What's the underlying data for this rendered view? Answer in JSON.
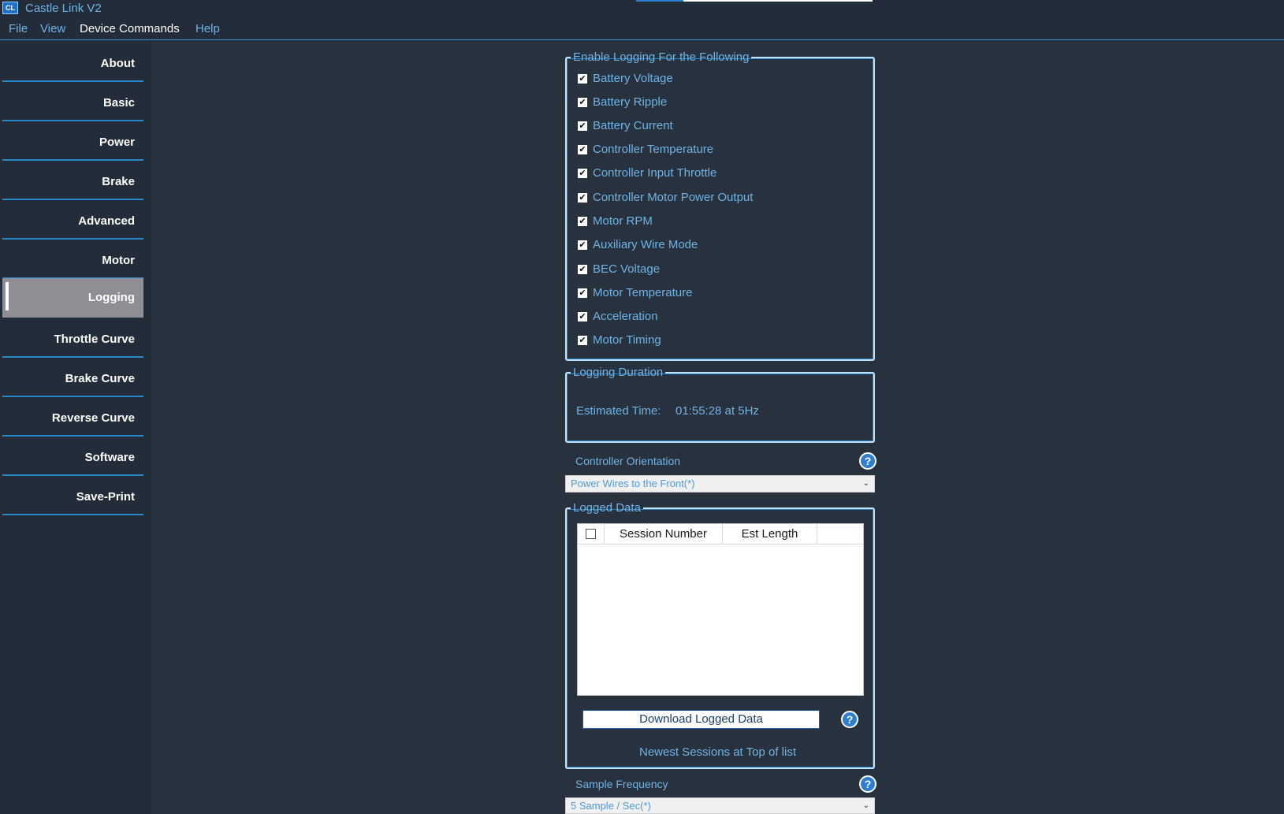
{
  "window": {
    "title": "Castle Link V2",
    "logo_text": "CL",
    "progress_fraction": 0.2
  },
  "menu": [
    "File",
    "View",
    "Device Commands",
    "Help"
  ],
  "sidebar": {
    "items": [
      {
        "label": "About"
      },
      {
        "label": "Basic"
      },
      {
        "label": "Power"
      },
      {
        "label": "Brake"
      },
      {
        "label": "Advanced"
      },
      {
        "label": "Motor"
      },
      {
        "label": "Logging",
        "active": true
      },
      {
        "label": "Throttle Curve"
      },
      {
        "label": "Brake Curve"
      },
      {
        "label": "Reverse Curve"
      },
      {
        "label": "Software"
      },
      {
        "label": "Save-Print"
      }
    ]
  },
  "logging_enable": {
    "legend": "Enable Logging For the Following",
    "items": [
      {
        "label": "Battery Voltage",
        "checked": true
      },
      {
        "label": "Battery Ripple",
        "checked": true
      },
      {
        "label": "Battery Current",
        "checked": true
      },
      {
        "label": "Controller Temperature",
        "checked": true
      },
      {
        "label": "Controller Input Throttle",
        "checked": true
      },
      {
        "label": "Controller Motor Power Output",
        "checked": true
      },
      {
        "label": "Motor RPM",
        "checked": true
      },
      {
        "label": "Auxiliary Wire Mode",
        "checked": true
      },
      {
        "label": "BEC Voltage",
        "checked": true
      },
      {
        "label": "Motor Temperature",
        "checked": true
      },
      {
        "label": "Acceleration",
        "checked": true
      },
      {
        "label": "Motor Timing",
        "checked": true
      }
    ]
  },
  "logging_duration": {
    "legend": "Logging Duration",
    "estimated_label": "Estimated Time:",
    "estimated_value": "01:55:28 at 5Hz"
  },
  "controller_orientation": {
    "label": "Controller Orientation",
    "value": "Power Wires to the Front(*)"
  },
  "logged_data": {
    "legend": "Logged Data",
    "columns": [
      "Session Number",
      "Est Length"
    ],
    "download_label": "Download Logged Data",
    "note": "Newest Sessions at Top of list"
  },
  "sample_frequency": {
    "label": "Sample Frequency",
    "value": "5 Sample / Sec(*)"
  },
  "icons": {
    "help": "?",
    "check": "✔",
    "chevron": "⌄"
  }
}
